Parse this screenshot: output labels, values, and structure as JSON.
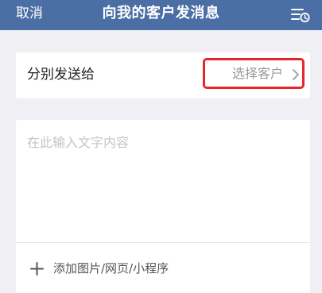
{
  "header": {
    "cancel_label": "取消",
    "title": "向我的客户发消息",
    "history_icon": "list-clock-icon"
  },
  "recipient": {
    "label": "分别发送给",
    "select_label": "选择客户",
    "chevron_icon": "chevron-right-icon"
  },
  "message": {
    "placeholder": "在此输入文字内容",
    "value": ""
  },
  "attach": {
    "icon": "plus-icon",
    "label": "添加图片/网页/小程序"
  },
  "colors": {
    "header_bg": "#4b6ea4",
    "page_bg": "#efeff4",
    "highlight": "#e8262b"
  }
}
